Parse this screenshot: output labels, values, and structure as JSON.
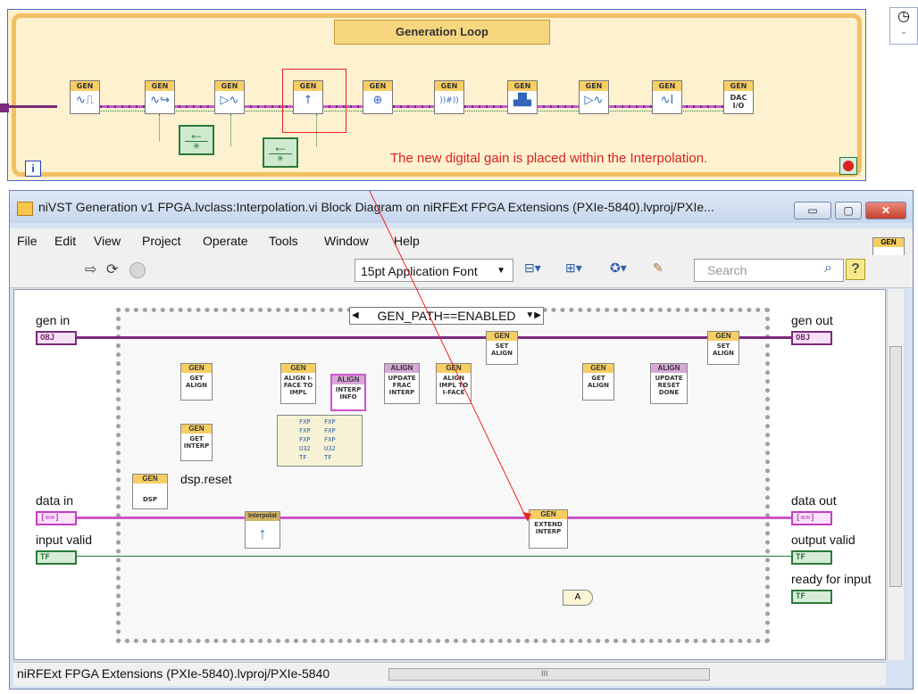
{
  "generation_loop": {
    "title": "Generation Loop",
    "iteration_terminal": "i",
    "annotation": "The new digital gain is placed within the Interpolation.",
    "vis": [
      {
        "header": "GEN",
        "icon": "∿⎍"
      },
      {
        "header": "GEN",
        "icon": "∿↪"
      },
      {
        "header": "GEN",
        "icon": "▷∿"
      },
      {
        "header": "GEN",
        "icon": "↑"
      },
      {
        "header": "GEN",
        "icon": "⊕"
      },
      {
        "header": "GEN",
        "icon": "))#))"
      },
      {
        "header": "GEN",
        "icon": "▟▙"
      },
      {
        "header": "GEN",
        "icon": "▷∿"
      },
      {
        "header": "GEN",
        "icon": "∿I"
      },
      {
        "header": "GEN",
        "line1": "DAC",
        "line2": "I/O"
      }
    ],
    "feedback_nodes": [
      {
        "arrow": "←",
        "star": "✳"
      },
      {
        "arrow": "←",
        "star": "✳"
      }
    ]
  },
  "window": {
    "title": "niVST Generation v1 FPGA.lvclass:Interpolation.vi Block Diagram on niRFExt FPGA Extensions (PXIe-5840).lvproj/PXIe...",
    "buttons": {
      "minimize": "▭",
      "maximize": "▢",
      "close": "✕"
    },
    "menu": [
      "File",
      "Edit",
      "View",
      "Project",
      "Operate",
      "Tools",
      "Window",
      "Help"
    ],
    "toolbar": {
      "font": "15pt Application Font",
      "search_placeholder": "Search",
      "help": "?"
    },
    "connector_pane": {
      "header": "GEN",
      "icon": "↑"
    },
    "status_path": "niRFExt FPGA Extensions (PXIe-5840).lvproj/PXIe-5840",
    "scroll_ticks": "III"
  },
  "diagram": {
    "case_selector": "GEN_PATH==ENABLED",
    "labels": {
      "gen_in": "gen in",
      "data_in": "data in",
      "input_valid": "input valid",
      "gen_out": "gen out",
      "data_out": "data out",
      "output_valid": "output valid",
      "ready_for_input": "ready for input",
      "dsp_reset": "dsp.reset"
    },
    "terminals": {
      "obj": "OBJ",
      "data": "[==]",
      "tf": "TF"
    },
    "nodes": {
      "get_align": {
        "header": "GEN",
        "text": "GET ALIGN"
      },
      "get_interp": {
        "header": "GEN",
        "text": "GET INTERP"
      },
      "align_iface": {
        "header": "GEN",
        "text": "ALIGN I-FACE TO IMPL"
      },
      "interp_info": {
        "header": "ALIGN",
        "text": "INTERP INFO"
      },
      "update_frac": {
        "header": "ALIGN",
        "text": "UPDATE FRAC INTERP"
      },
      "align_impl": {
        "header": "GEN",
        "text": "ALIGN IMPL TO I-FACE"
      },
      "set_align_1": {
        "header": "GEN",
        "text": "SET ALIGN"
      },
      "extend_interp": {
        "header": "GEN",
        "text": "EXTEND INTERP"
      },
      "get_align_2": {
        "header": "GEN",
        "text": "GET ALIGN"
      },
      "update_reset": {
        "header": "ALIGN",
        "text": "UPDATE RESET DONE"
      },
      "set_align_2": {
        "header": "GEN",
        "text": "SET ALIGN"
      },
      "dsp": {
        "header": "GEN",
        "text": "DSP"
      },
      "interpolator": {
        "header": "Interpolat",
        "icon": "↑"
      },
      "and_gate": "A"
    },
    "bundle_fields": [
      "FXP",
      "FXP",
      "FXP",
      "U32",
      "TF"
    ]
  }
}
